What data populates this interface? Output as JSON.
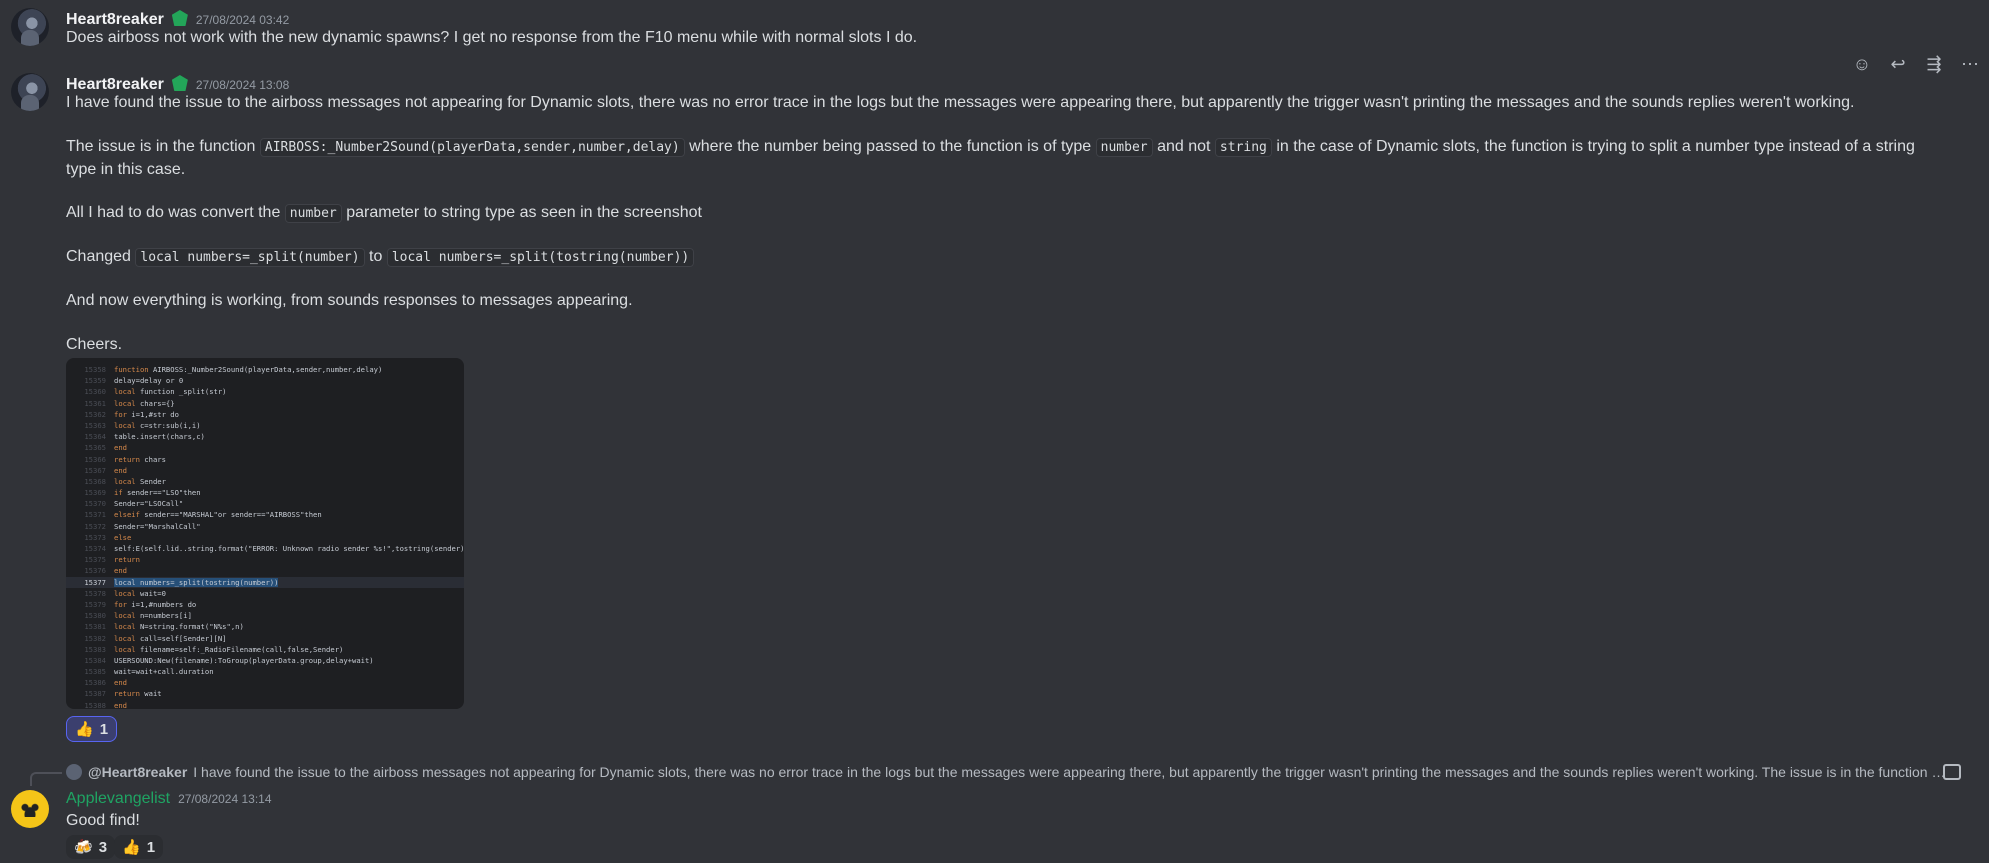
{
  "messages": [
    {
      "author": "Heart8reaker",
      "timestamp": "27/08/2024 03:42",
      "text": "Does airboss not work with the new dynamic spawns? I get no response from the F10 menu while with normal slots I do."
    },
    {
      "author": "Heart8reaker",
      "timestamp": "27/08/2024 13:08",
      "p1": "I have found the issue to the airboss messages not appearing for Dynamic slots, there was no error trace in the logs but the messages were appearing there, but apparently the trigger wasn't printing the messages and the sounds replies weren't working.",
      "p2_a": "The issue is in the function",
      "p2_code1": "AIRBOSS:_Number2Sound(playerData,sender,number,delay)",
      "p2_b": "where the number being passed to the function is of type",
      "p2_code2": "number",
      "p2_c": "and not",
      "p2_code3": "string",
      "p2_d": "in the case of Dynamic slots, the function is trying to split a number type instead of a string type in this case.",
      "p3_a": "All I had to do was convert the",
      "p3_code": "number",
      "p3_b": "parameter to string type as seen in the screenshot",
      "p4_a": "Changed",
      "p4_code1": "local numbers=_split(number)",
      "p4_b": "to",
      "p4_code2": "local numbers=_split(tostring(number))",
      "p5": "And now everything is working, from sounds responses to messages appearing.",
      "p6": "Cheers.",
      "reaction": {
        "emoji": "👍",
        "count": "1"
      }
    },
    {
      "author": "Applevangelist",
      "timestamp": "27/08/2024 13:14",
      "reply_to": "@Heart8reaker",
      "reply_preview": "I have found the issue to the airboss messages not appearing for Dynamic slots, there was no error trace in the logs but the messages were appearing there, but apparently the trigger wasn't printing the messages and the sounds replies weren't working.  The issue is in the function …",
      "text": "Good find!",
      "reactions": [
        {
          "emoji": "🍻",
          "count": "3"
        },
        {
          "emoji": "👍",
          "count": "1"
        }
      ]
    }
  ],
  "toolbar": {
    "icons": [
      "add-reaction-icon",
      "reply-icon",
      "forward-icon",
      "more-icon"
    ],
    "glyphs": [
      "☺",
      "↩",
      "⇶",
      "⋯"
    ]
  },
  "code_lines": [
    {
      "n": "15358",
      "t": "function AIRBOSS:_Number2Sound(playerData,sender,number,delay)"
    },
    {
      "n": "15359",
      "t": "delay=delay or 0"
    },
    {
      "n": "15360",
      "t": "local function _split(str)"
    },
    {
      "n": "15361",
      "t": "local chars={}"
    },
    {
      "n": "15362",
      "t": "for i=1,#str do"
    },
    {
      "n": "15363",
      "t": "local c=str:sub(i,i)"
    },
    {
      "n": "15364",
      "t": "table.insert(chars,c)"
    },
    {
      "n": "15365",
      "t": "end"
    },
    {
      "n": "15366",
      "t": "return chars"
    },
    {
      "n": "15367",
      "t": "end"
    },
    {
      "n": "15368",
      "t": "local Sender"
    },
    {
      "n": "15369",
      "t": "if sender==\"LSO\"then"
    },
    {
      "n": "15370",
      "t": "Sender=\"LSOCall\""
    },
    {
      "n": "15371",
      "t": "elseif sender==\"MARSHAL\"or sender==\"AIRBOSS\"then"
    },
    {
      "n": "15372",
      "t": "Sender=\"MarshalCall\""
    },
    {
      "n": "15373",
      "t": "else"
    },
    {
      "n": "15374",
      "t": "self:E(self.lid..string.format(\"ERROR: Unknown radio sender %s!\",tostring(sender)))"
    },
    {
      "n": "15375",
      "t": "return"
    },
    {
      "n": "15376",
      "t": "end"
    },
    {
      "n": "15377",
      "t": "local numbers=_split(tostring(number))"
    },
    {
      "n": "15378",
      "t": "local wait=0"
    },
    {
      "n": "15379",
      "t": "for i=1,#numbers do"
    },
    {
      "n": "15380",
      "t": "local n=numbers[i]"
    },
    {
      "n": "15381",
      "t": "local N=string.format(\"N%s\",n)"
    },
    {
      "n": "15382",
      "t": "local call=self[Sender][N]"
    },
    {
      "n": "15383",
      "t": "local filename=self:_RadioFilename(call,false,Sender)"
    },
    {
      "n": "15384",
      "t": "USERSOUND:New(filename):ToGroup(playerData.group,delay+wait)"
    },
    {
      "n": "15385",
      "t": "wait=wait+call.duration"
    },
    {
      "n": "15386",
      "t": "end"
    },
    {
      "n": "15387",
      "t": "return wait"
    },
    {
      "n": "15388",
      "t": "end"
    }
  ]
}
